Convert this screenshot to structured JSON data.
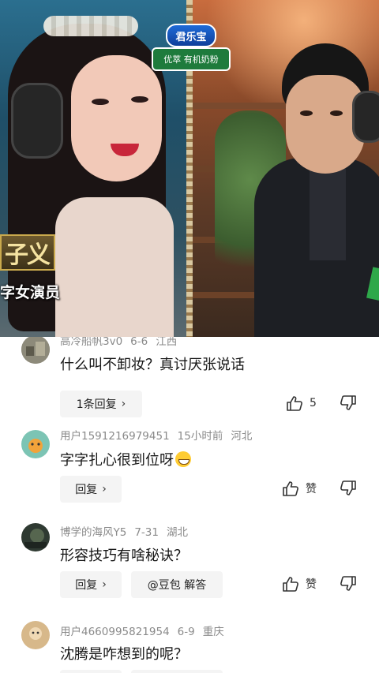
{
  "video": {
    "brand_name": "君乐宝",
    "brand_tagline": "优萃 有机奶粉",
    "caption_title": "子义",
    "caption_subtitle": "字女演员"
  },
  "comments": [
    {
      "username": "高冷船帆3v0",
      "date": "6-6",
      "location": "江西",
      "text": "什么叫不卸妆？真讨厌张说话",
      "reply_label": "1条回复",
      "like_count": "5",
      "avatar_color": "#8d8a7a"
    },
    {
      "username": "用户1591216979451",
      "date": "15小时前",
      "location": "河北",
      "text": "字字扎心很到位呀",
      "reply_label": "回复",
      "like_label": "赞",
      "avatar_color": "#7cc4b4"
    },
    {
      "username": "博学的海风Y5",
      "date": "7-31",
      "location": "湖北",
      "text": "形容技巧有啥秘诀？",
      "reply_label": "回复",
      "ai_button": "@豆包 解答",
      "like_label": "赞",
      "avatar_color": "#2f3a32"
    },
    {
      "username": "用户4660995821954",
      "date": "6-9",
      "location": "重庆",
      "text": "沈腾是咋想到的呢？",
      "avatar_color": "#d7b88a"
    }
  ],
  "colors": {
    "meta_gray": "#8a8a8a",
    "text_dark": "#161616",
    "pill_bg": "#f4f4f4"
  }
}
